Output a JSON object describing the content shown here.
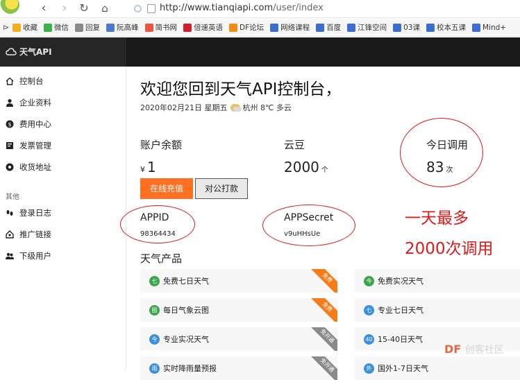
{
  "browser": {
    "url_host": "http://www.tianqiapi.com",
    "url_path": "/user/index",
    "bookmarks": [
      {
        "label": "收藏",
        "color": "#f2b01e"
      },
      {
        "label": "微信",
        "color": "#3bb34a"
      },
      {
        "label": "回复",
        "color": "#8a8a8a"
      },
      {
        "label": "阮高峰",
        "color": "#4a7bd0"
      },
      {
        "label": "简书网",
        "color": "#e9573f"
      },
      {
        "label": "倍速英语",
        "color": "#d0202b"
      },
      {
        "label": "DF论坛",
        "color": "#f08c1a"
      },
      {
        "label": "网络课程",
        "color": "#3b6ecf"
      },
      {
        "label": "百度",
        "color": "#3b6ecf"
      },
      {
        "label": "江锋空间",
        "color": "#3b6ecf"
      },
      {
        "label": "03课",
        "color": "#3b6ecf"
      },
      {
        "label": "校本五课",
        "color": "#3b6ecf"
      },
      {
        "label": "Mind+",
        "color": "#3b6ecf"
      }
    ]
  },
  "header": {
    "logo_text": "天气API"
  },
  "sidebar": {
    "items": [
      {
        "label": "控制台",
        "icon": "home-icon"
      },
      {
        "label": "企业资料",
        "icon": "user-icon"
      },
      {
        "label": "费用中心",
        "icon": "dollar-icon"
      },
      {
        "label": "发票管理",
        "icon": "invoice-icon"
      },
      {
        "label": "收货地址",
        "icon": "location-icon"
      }
    ],
    "category": "其他",
    "items2": [
      {
        "label": "登录日志",
        "icon": "footprint-icon"
      },
      {
        "label": "推广链接",
        "icon": "share-icon"
      },
      {
        "label": "下级用户",
        "icon": "users-icon"
      }
    ]
  },
  "main": {
    "welcome": "欢迎您回到天气API控制台，",
    "date_prefix": "2020年02月21日 星期五",
    "weather_text": "杭州 8℃ 多云",
    "balance_label": "账户余额",
    "balance_currency": "¥",
    "balance_value": "1",
    "coins_label": "云豆",
    "coins_value": "2000",
    "coins_unit": "个",
    "today_label": "今日调用",
    "today_value": "83",
    "today_unit": "次",
    "recharge_btn": "在线充值",
    "transfer_btn": "对公打款",
    "appid_label": "APPID",
    "appid_value": "98364434",
    "appsecret_label": "APPSecret",
    "appsecret_value": "v9uHHsUe",
    "annotation_line1": "一天最多",
    "annotation_line2": "2000次调用",
    "products_title": "天气产品",
    "products": [
      {
        "label": "免费七日天气",
        "badge": "七",
        "badge_color": "#3aa54a",
        "ribbon": "免费",
        "ribbon_style": "orange"
      },
      {
        "label": "免费实况天气",
        "badge": "今",
        "badge_color": "#3aa54a",
        "ribbon": "",
        "ribbon_style": ""
      },
      {
        "label": "每日气象云图",
        "badge": "图",
        "badge_color": "#3aa54a",
        "ribbon": "免费",
        "ribbon_style": "orange"
      },
      {
        "label": "专业七日天气",
        "badge": "七",
        "badge_color": "#3b8fe0",
        "ribbon": "",
        "ribbon_style": ""
      },
      {
        "label": "专业实况天气",
        "badge": "今",
        "badge_color": "#3b8fe0",
        "ribbon": "免开通",
        "ribbon_style": "gray"
      },
      {
        "label": "15-40日天气",
        "badge": "40",
        "badge_color": "#3b8fe0",
        "ribbon": "",
        "ribbon_style": ""
      },
      {
        "label": "实时降雨量预报",
        "badge": "雨",
        "badge_color": "#3b8fe0",
        "ribbon": "免开通",
        "ribbon_style": "gray"
      },
      {
        "label": "国外1-7日天气",
        "badge": "外",
        "badge_color": "#3b8fe0",
        "ribbon": "",
        "ribbon_style": ""
      }
    ]
  },
  "watermark": {
    "brand": "DF",
    "text": "创客社区"
  }
}
